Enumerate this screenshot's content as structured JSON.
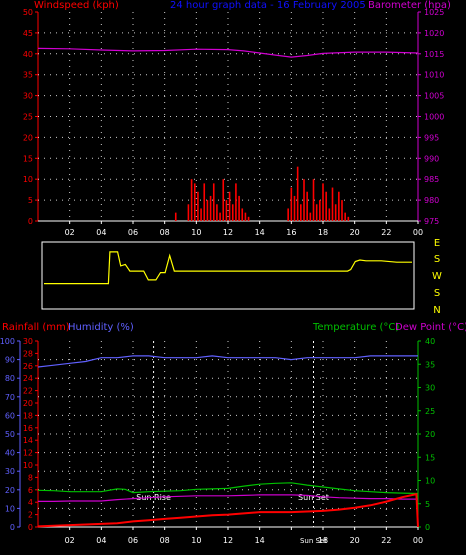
{
  "colors": {
    "wind": "#ff0000",
    "gust": "#ff0000",
    "barometer": "#d000d0",
    "direction": "#ffff00",
    "rainfall": "#ff0000",
    "humidity": "#6060ff",
    "temperature": "#00c000",
    "dewpoint": "#cc00cc",
    "title": "#1010ff",
    "axis_text": "#ffffff",
    "background": "#000000",
    "grid": "#ffffff"
  },
  "top": {
    "title": "24 hour graph data - 16 February 2005",
    "left_label": "Windspeed (kph)",
    "right_label": "Barometer (hpa)"
  },
  "bottom": {
    "rain_label": "Rainfall (mm)",
    "humidity_label": "Humidity (%)",
    "temp_label": "Temperature (°C)",
    "dew_label": "Dew Point (°C)",
    "sunrise_label": "Sun Rise",
    "sunset_label": "Sun Set",
    "sunset_axis_label": "Sun Set"
  },
  "direction_labels": [
    "E",
    "S",
    "W",
    "S",
    "N"
  ],
  "chart_data": [
    {
      "type": "line",
      "name": "wind-and-pressure",
      "xlabel": "",
      "x_ticks": [
        "02",
        "04",
        "06",
        "08",
        "10",
        "12",
        "14",
        "16",
        "18",
        "20",
        "22",
        "00"
      ],
      "wind_axis": {
        "ticks": [
          0,
          5,
          10,
          15,
          20,
          25,
          30,
          35,
          40,
          45,
          50
        ],
        "ylim": [
          0,
          50
        ]
      },
      "pressure_axis": {
        "ticks": [
          975,
          980,
          985,
          990,
          995,
          1000,
          1005,
          1010,
          1015,
          1020,
          1025
        ],
        "ylim": [
          975,
          1025
        ]
      },
      "series": [
        {
          "name": "Windspeed (kph)",
          "axis": "wind",
          "kind": "bars",
          "x": [
            8.7,
            9.5,
            9.7,
            9.9,
            10.1,
            10.3,
            10.5,
            10.7,
            10.9,
            11.1,
            11.3,
            11.5,
            11.7,
            11.9,
            12.1,
            12.3,
            12.5,
            12.7,
            12.9,
            13.1,
            13.3,
            15.8,
            16.0,
            16.2,
            16.4,
            16.6,
            16.8,
            17.0,
            17.2,
            17.4,
            17.6,
            17.8,
            18.0,
            18.2,
            18.4,
            18.6,
            18.8,
            19.0,
            19.2,
            19.4,
            19.6
          ],
          "values": [
            2,
            4,
            10,
            9,
            7,
            3,
            9,
            5,
            6,
            9,
            4,
            2,
            10,
            5,
            7,
            4,
            9,
            6,
            3,
            2,
            1,
            3,
            8,
            6,
            13,
            4,
            10,
            7,
            2,
            10,
            4,
            5,
            9,
            7,
            3,
            8,
            4,
            7,
            5,
            2,
            1
          ]
        },
        {
          "name": "Barometer (hpa)",
          "axis": "pressure",
          "x": [
            0,
            2,
            4,
            6,
            8,
            10,
            12,
            13,
            14,
            15,
            16,
            17,
            18,
            20,
            22,
            24
          ],
          "values": [
            1016.3,
            1016.2,
            1015.9,
            1015.7,
            1015.8,
            1016.1,
            1016.0,
            1015.7,
            1015.2,
            1014.7,
            1014.2,
            1014.6,
            1015.1,
            1015.4,
            1015.4,
            1015.2
          ]
        }
      ]
    },
    {
      "type": "line",
      "name": "wind-direction",
      "x_ticks": [],
      "series": [
        {
          "name": "Direction",
          "x": [
            0,
            4.2,
            4.3,
            4.8,
            5.0,
            5.3,
            5.6,
            5.8,
            6.0,
            6.5,
            6.8,
            7.0,
            7.3,
            7.6,
            7.9,
            8.2,
            8.5,
            9.0,
            9.5,
            16.0,
            17.0,
            18.0,
            19.0,
            19.8,
            20.0,
            20.3,
            20.6,
            21.0,
            22.0,
            23.0,
            24.0
          ],
          "values": [
            1.45,
            1.45,
            3.6,
            3.6,
            2.65,
            2.75,
            2.3,
            2.3,
            2.3,
            2.3,
            1.7,
            1.7,
            1.7,
            2.2,
            2.2,
            3.35,
            2.3,
            2.3,
            2.3,
            2.3,
            2.3,
            2.3,
            2.3,
            2.3,
            2.4,
            2.95,
            3.05,
            3.0,
            3.0,
            2.9,
            2.9
          ]
        }
      ]
    },
    {
      "type": "line",
      "name": "rain-humidity-temperature",
      "x_ticks": [
        "02",
        "04",
        "06",
        "08",
        "10",
        "12",
        "14",
        "16",
        "18",
        "20",
        "22",
        "00"
      ],
      "humidity_axis": {
        "ticks": [
          0,
          10,
          20,
          30,
          40,
          50,
          60,
          70,
          80,
          90,
          100
        ],
        "ylim": [
          0,
          100
        ]
      },
      "rain_axis": {
        "ticks": [
          0,
          2,
          4,
          6,
          8,
          10,
          12,
          14,
          16,
          18,
          20,
          22,
          24,
          26,
          28,
          30
        ],
        "ylim": [
          0,
          30
        ]
      },
      "temp_axis": {
        "ticks": [
          0,
          5,
          10,
          15,
          20,
          25,
          30,
          35,
          40
        ],
        "ylim": [
          0,
          40
        ]
      },
      "series": [
        {
          "name": "Humidity (%)",
          "axis": "humidity",
          "x": [
            0,
            1,
            2,
            3,
            4,
            5,
            6,
            7,
            8,
            9,
            10,
            11,
            12,
            13,
            14,
            15,
            16,
            17,
            18,
            19,
            20,
            21,
            22,
            23,
            24
          ],
          "values": [
            86,
            87,
            88,
            89,
            91,
            91,
            92,
            92,
            91,
            91,
            91,
            92,
            91,
            91,
            91,
            91,
            90,
            91,
            91,
            91,
            91,
            92,
            92,
            92,
            92
          ]
        },
        {
          "name": "Rainfall (mm)",
          "axis": "rain",
          "x": [
            0,
            2,
            4,
            5,
            6,
            7,
            8,
            9,
            10,
            11,
            12,
            13,
            14,
            15,
            16,
            17,
            18,
            19,
            20,
            21,
            22,
            23,
            23.9,
            24
          ],
          "values": [
            0.1,
            0.3,
            0.5,
            0.6,
            0.9,
            1.1,
            1.3,
            1.5,
            1.7,
            1.9,
            2.0,
            2.2,
            2.4,
            2.4,
            2.4,
            2.5,
            2.6,
            2.8,
            3.1,
            3.5,
            4.1,
            4.8,
            5.3,
            0
          ]
        },
        {
          "name": "Temperature (°C)",
          "axis": "temp",
          "x": [
            0,
            1,
            2,
            3,
            4,
            5,
            5.5,
            6,
            7,
            8,
            9,
            10,
            11,
            12,
            13,
            14,
            15,
            16,
            17,
            18,
            19,
            20,
            21,
            22,
            23,
            24
          ],
          "values": [
            7.9,
            7.8,
            7.6,
            7.6,
            7.6,
            8.2,
            8.1,
            7.4,
            7.6,
            7.7,
            7.8,
            8.1,
            8.2,
            8.3,
            8.8,
            9.2,
            9.4,
            9.5,
            9.0,
            8.6,
            8.2,
            7.8,
            7.6,
            7.4,
            7.3,
            7.2
          ]
        },
        {
          "name": "Dew Point (°C)",
          "axis": "temp",
          "x": [
            0,
            1,
            2,
            3,
            4,
            5,
            6,
            7,
            8,
            9,
            10,
            11,
            12,
            13,
            14,
            15,
            16,
            17,
            18,
            19,
            20,
            21,
            22,
            23,
            24
          ],
          "values": [
            5.5,
            5.5,
            5.6,
            5.6,
            5.6,
            5.9,
            6.1,
            6.3,
            6.5,
            6.6,
            6.7,
            6.7,
            6.7,
            6.8,
            6.9,
            6.9,
            6.9,
            6.8,
            6.5,
            6.3,
            6.2,
            6.1,
            6.1,
            6.0,
            6.0
          ]
        }
      ],
      "sunrise_x": 7.3,
      "sunset_x": 17.4
    }
  ]
}
